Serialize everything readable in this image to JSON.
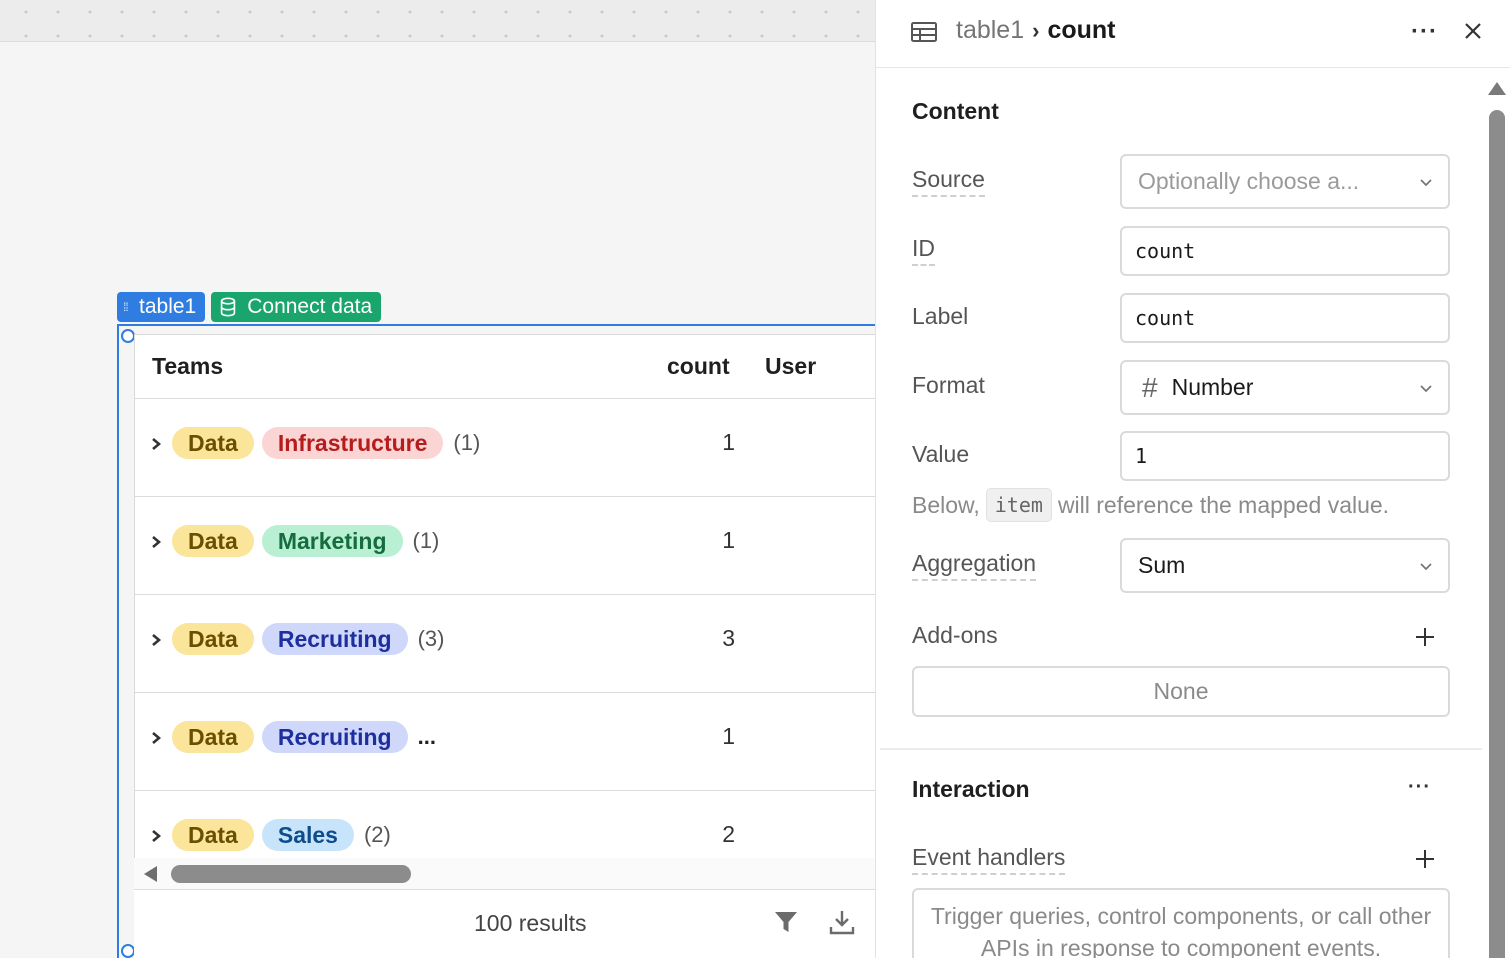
{
  "table_tag": {
    "label": "table1"
  },
  "connect_tag": {
    "label": "Connect data"
  },
  "table": {
    "columns": [
      "Teams",
      "count",
      "User"
    ],
    "rows": [
      {
        "tags": [
          "Data",
          "Infrastructure"
        ],
        "group_count": "(1)",
        "value": "1"
      },
      {
        "tags": [
          "Data",
          "Marketing"
        ],
        "group_count": "(1)",
        "value": "1"
      },
      {
        "tags": [
          "Data",
          "Recruiting"
        ],
        "group_count": "(3)",
        "value": "3"
      },
      {
        "tags": [
          "Data",
          "Recruiting"
        ],
        "group_count": "...",
        "value": "1"
      },
      {
        "tags": [
          "Data",
          "Sales"
        ],
        "group_count": "(2)",
        "value": "2"
      }
    ],
    "results_label": "100 results"
  },
  "panel": {
    "breadcrumb_parent": "table1",
    "breadcrumb_current": "count",
    "content_title": "Content",
    "source": {
      "label": "Source",
      "placeholder": "Optionally choose a..."
    },
    "id": {
      "label": "ID",
      "value": "count"
    },
    "label": {
      "label": "Label",
      "value": "count"
    },
    "format": {
      "label": "Format",
      "icon": "#",
      "value": "Number"
    },
    "value": {
      "label": "Value",
      "value": "1"
    },
    "hint": {
      "before": "Below,",
      "code": "item",
      "after": "will reference the mapped value."
    },
    "aggregation": {
      "label": "Aggregation",
      "value": "Sum"
    },
    "addons": {
      "label": "Add-ons",
      "empty": "None"
    },
    "interaction_title": "Interaction",
    "event_handlers": {
      "label": "Event handlers",
      "placeholder": "Trigger queries, control components, or call other APIs in response to component events."
    }
  },
  "colors": {
    "selection": "#2f7de1",
    "connect": "#1aa56d"
  }
}
